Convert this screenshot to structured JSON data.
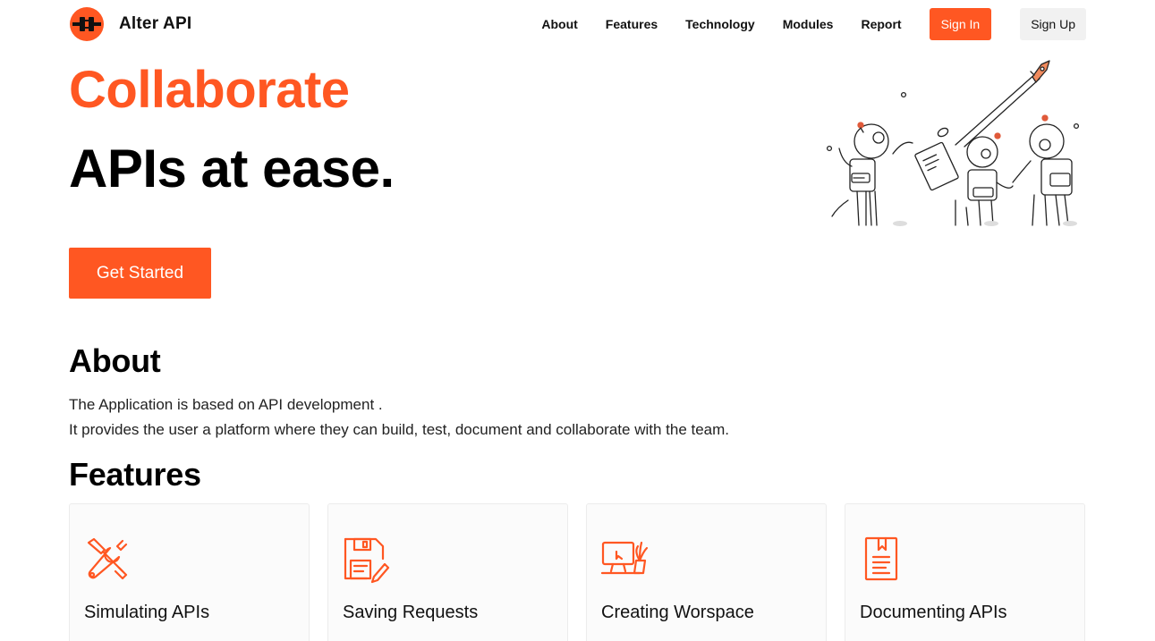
{
  "brand": {
    "name": "Alter API",
    "accent": "#ff5722"
  },
  "nav": {
    "links": [
      "About",
      "Features",
      "Technology",
      "Modules",
      "Report"
    ],
    "sign_in": "Sign In",
    "sign_up": "Sign Up"
  },
  "hero": {
    "line1": "Collaborate",
    "line2": "APIs at ease.",
    "cta": "Get Started"
  },
  "about": {
    "title": "About",
    "lines": [
      "The Application is based on API development .",
      "It provides the user a platform where they can build, test, document and collaborate with the team."
    ]
  },
  "features": {
    "title": "Features",
    "cards": [
      {
        "label": "Simulating APIs",
        "icon": "tools-icon"
      },
      {
        "label": "Saving Requests",
        "icon": "floppy-edit-icon"
      },
      {
        "label": "Creating Worspace",
        "icon": "workspace-monitor-icon"
      },
      {
        "label": "Documenting APIs",
        "icon": "document-icon"
      }
    ]
  }
}
